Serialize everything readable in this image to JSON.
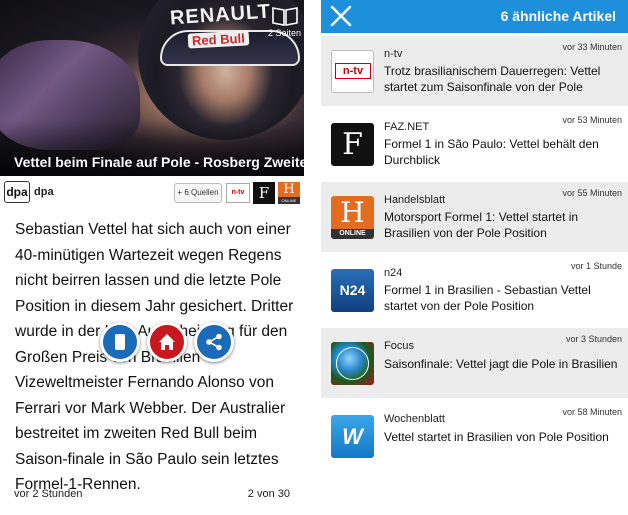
{
  "article": {
    "pages_label": "2 Seiten",
    "caption": "Vettel beim Finale auf Pole - Rosberg Zweiter",
    "hero_logo_top": "RENAULT",
    "hero_logo_bottom": "Red Bull",
    "source_logo": "dpa",
    "source_name": "dpa",
    "sources_button": "+ 6 Quellen",
    "mini_logos": {
      "ntv": "n-tv",
      "faz": "F",
      "handelsblatt": "H",
      "handelsblatt_sub": "ONLINE"
    },
    "body": "Sebastian Vettel hat sich auch von einer 40-minütigen Wartezeit wegen Regens nicht beirren lassen und die letzte Pole Position in diesem Jahr gesichert. Dritter wurde in der K.o.-Ausscheidung für den Großen Preis von Brasilien Vizeweltmeister Fernando Alonso von Ferrari vor Mark Webber. Der Australier bestreitet im zweiten Red Bull beim Saison-finale in São Paulo sein letztes Formel-1-Rennen.",
    "time": "vor 2 Stunden",
    "page_indicator": "2 von 30"
  },
  "fab_icons": [
    "pages-icon",
    "home-icon",
    "share-icon"
  ],
  "related": {
    "title": "6 ähnliche Artikel",
    "items": [
      {
        "source": "n-tv",
        "logo_text": "n-tv",
        "time": "vor 33 Minuten",
        "title": "Trotz brasilianischem Dauerregen: Vettel startet zum Saisonfinale von der Pole"
      },
      {
        "source": "FAZ.NET",
        "logo_text": "F",
        "time": "vor 53 Minuten",
        "title": "Formel 1 in São Paulo: Vettel behält den Durchblick"
      },
      {
        "source": "Handelsblatt",
        "logo_text": "H",
        "logo_sub": "ONLINE",
        "time": "vor 55 Minuten",
        "title": "Motorsport Formel 1: Vettel startet in Brasilien von der Pole Position"
      },
      {
        "source": "n24",
        "logo_text": "N24",
        "time": "vor 1 Stunde",
        "title": "Formel 1 in Brasilien - Sebastian Vettel startet von der Pole Position"
      },
      {
        "source": "Focus",
        "logo_text": "",
        "time": "vor 3 Stunden",
        "title": "Saisonfinale: Vettel jagt die Pole in Brasilien"
      },
      {
        "source": "Wochenblatt",
        "logo_text": "W",
        "time": "vor 58 Minuten",
        "title": "Vettel startet in Brasilien von Pole Position"
      }
    ]
  },
  "colors": {
    "accent": "#1e8fdb",
    "home_fab": "#c8181e",
    "alt_row": "#ececec"
  }
}
